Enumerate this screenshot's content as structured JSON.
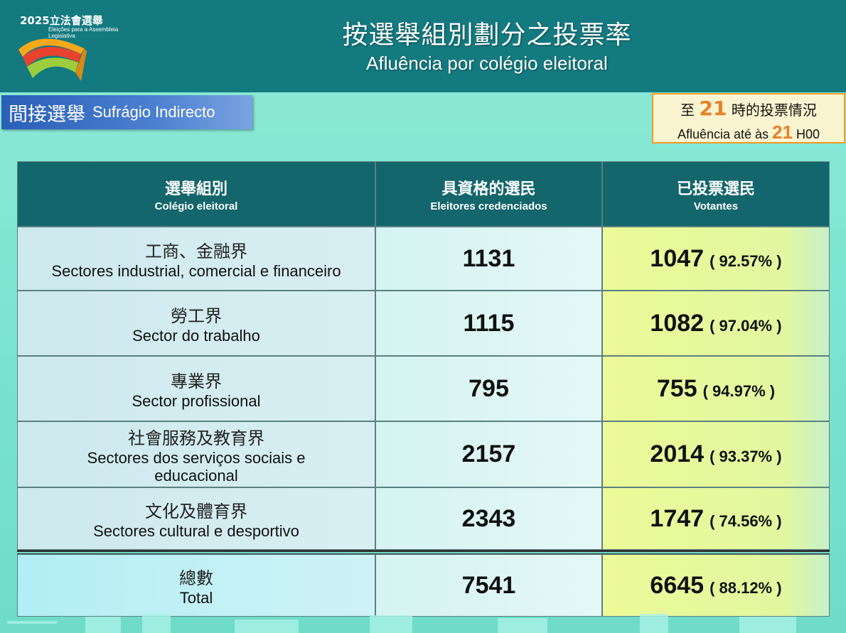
{
  "logo": {
    "year_title": "2025立法會選舉",
    "subtitle": "Eleições para a Assembleia Legislativa"
  },
  "title": {
    "zh": "按選舉組別劃分之投票率",
    "pt": "Afluência por colégio eleitoral"
  },
  "badge": {
    "zh": "間接選舉",
    "pt": "Sufrágio Indirecto"
  },
  "timebox": {
    "l1_pre": "至",
    "hour": "21",
    "l1_post": "時的投票情況",
    "l2_pre": "Afluência até às",
    "l2_post": "H00"
  },
  "headers": {
    "col1_zh": "選舉組別",
    "col1_pt": "Colégio eleitoral",
    "col2_zh": "具資格的選民",
    "col2_pt": "Eleitores credenciados",
    "col3_zh": "已投票選民",
    "col3_pt": "Votantes"
  },
  "rows": [
    {
      "zh": "工商、金融界",
      "pt": "Sectores industrial, comercial e financeiro",
      "eligible": "1131",
      "voted": "1047",
      "pct": "( 92.57% )"
    },
    {
      "zh": "勞工界",
      "pt": "Sector do trabalho",
      "eligible": "1115",
      "voted": "1082",
      "pct": "( 97.04% )"
    },
    {
      "zh": "專業界",
      "pt": "Sector profissional",
      "eligible": "795",
      "voted": "755",
      "pct": "( 94.97% )"
    },
    {
      "zh": "社會服務及教育界",
      "pt": "Sectores dos serviços sociais e educacional",
      "eligible": "2157",
      "voted": "2014",
      "pct": "( 93.37% )"
    },
    {
      "zh": "文化及體育界",
      "pt": "Sectores cultural e desportivo",
      "eligible": "2343",
      "voted": "1747",
      "pct": "( 74.56% )"
    }
  ],
  "total": {
    "zh": "總數",
    "pt": "Total",
    "eligible": "7541",
    "voted": "6645",
    "pct": "( 88.12% )"
  }
}
